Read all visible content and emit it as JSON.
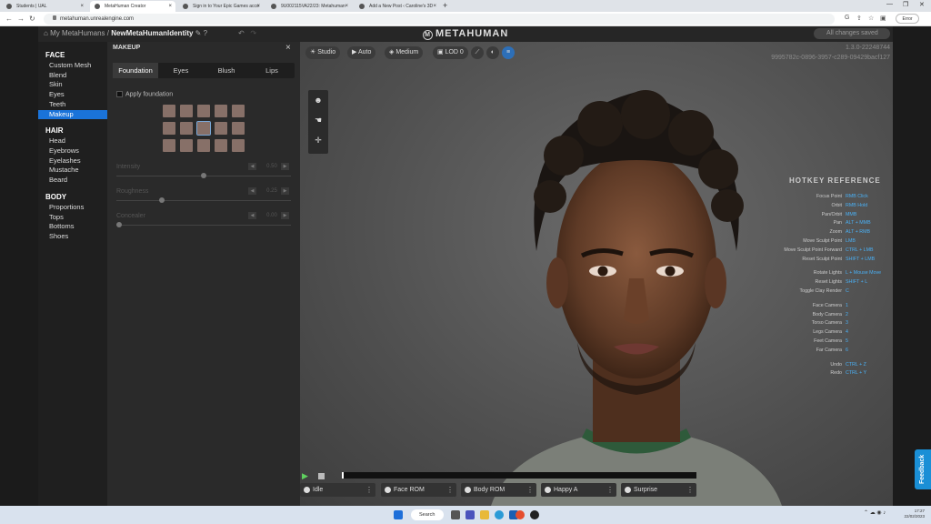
{
  "browser": {
    "tabs": [
      {
        "title": "Students | UAL"
      },
      {
        "title": "MetaHuman Creator"
      },
      {
        "title": "Sign in to Your Epic Games acco"
      },
      {
        "title": "9U002115VA22/23: Metahuman"
      },
      {
        "title": "Add a New Post ‹ Caroline's 3D"
      }
    ],
    "url": "metahuman.unrealengine.com",
    "profile_label": "Error"
  },
  "app": {
    "breadcrumb_root": "My MetaHumans /",
    "breadcrumb_current": "NewMetaHumanIdentity",
    "logo_text": "METAHUMAN",
    "saved_status": "All changes saved",
    "version": "1.3.0-22248744",
    "id": "9995782c-0896-3957-c289-09429bacf127"
  },
  "sidebar": {
    "face_header": "FACE",
    "face_items": [
      "Custom Mesh",
      "Blend",
      "Skin",
      "Eyes",
      "Teeth",
      "Makeup"
    ],
    "hair_header": "HAIR",
    "hair_items": [
      "Head",
      "Eyebrows",
      "Eyelashes",
      "Mustache",
      "Beard"
    ],
    "body_header": "BODY",
    "body_items": [
      "Proportions",
      "Tops",
      "Bottoms",
      "Shoes"
    ]
  },
  "panel": {
    "title": "MAKEUP",
    "tabs": [
      "Foundation",
      "Eyes",
      "Blush",
      "Lips"
    ],
    "apply_label": "Apply foundation",
    "sliders": [
      {
        "label": "Intensity",
        "value_text": "0.50",
        "fraction": 0.5
      },
      {
        "label": "Roughness",
        "value_text": "0.25",
        "fraction": 0.25
      },
      {
        "label": "Concealer",
        "value_text": "0.00",
        "fraction": 0.0
      }
    ]
  },
  "viewport": {
    "buttons": {
      "studio": "Studio",
      "auto": "Auto",
      "medium": "Medium",
      "lod": "LOD 0"
    },
    "hotkey_header": "HOTKEY REFERENCE",
    "hotkeys": [
      {
        "action": "Focus Point",
        "key": "RMB Click"
      },
      {
        "action": "Orbit",
        "key": "RMB Hold"
      },
      {
        "action": "Pan/Orbit",
        "key": "MMB"
      },
      {
        "action": "Pan",
        "key": "ALT + MMB"
      },
      {
        "action": "Zoom",
        "key": "ALT + RMB"
      },
      {
        "action": "Move Sculpt Point",
        "key": "LMB"
      },
      {
        "action": "Move Sculpt Point Forward",
        "key": "CTRL + LMB"
      },
      {
        "action": "Reset Sculpt Point",
        "key": "SHIFT + LMB"
      },
      {
        "action": "Rotate Lights",
        "key": "L + Mouse Move"
      },
      {
        "action": "Reset Lights",
        "key": "SHIFT + L"
      },
      {
        "action": "Toggle Clay Render",
        "key": "C"
      },
      {
        "action": "Face Camera",
        "key": "1"
      },
      {
        "action": "Body Camera",
        "key": "2"
      },
      {
        "action": "Torso Camera",
        "key": "3"
      },
      {
        "action": "Legs Camera",
        "key": "4"
      },
      {
        "action": "Feet Camera",
        "key": "5"
      },
      {
        "action": "Far Camera",
        "key": "6"
      },
      {
        "action": "Undo",
        "key": "CTRL + Z"
      },
      {
        "action": "Redo",
        "key": "CTRL + Y"
      }
    ],
    "animations": [
      "Idle",
      "Face ROM",
      "Body ROM",
      "Happy A",
      "Surprise"
    ]
  },
  "feedback_label": "Feedback",
  "taskbar": {
    "search": "Search",
    "time": "17:27",
    "date": "22/02/2023"
  },
  "colors": {
    "accent_blue": "#1a73d9",
    "hotkey_blue": "#4ab0f5",
    "play_green": "#5fd15f"
  }
}
